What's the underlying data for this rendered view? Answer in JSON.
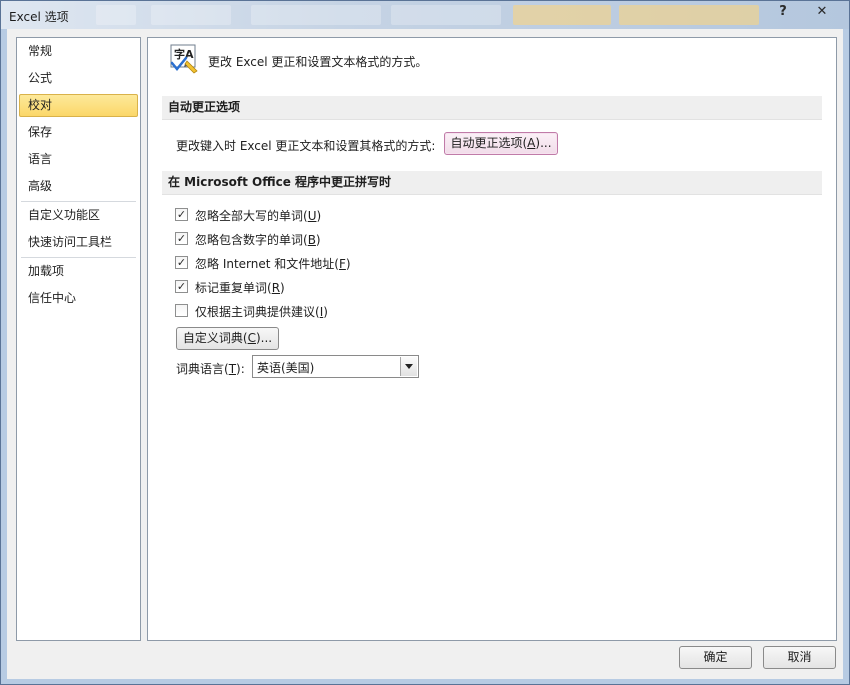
{
  "window": {
    "title": "Excel 选项",
    "help_glyph": "?",
    "close_glyph": "✕"
  },
  "nav": {
    "items": [
      {
        "label": "常规"
      },
      {
        "label": "公式"
      },
      {
        "label": "校对"
      },
      {
        "label": "保存"
      },
      {
        "label": "语言"
      },
      {
        "label": "高级"
      },
      {
        "label": "自定义功能区"
      },
      {
        "label": "快速访问工具栏"
      },
      {
        "label": "加载项"
      },
      {
        "label": "信任中心"
      }
    ],
    "selected": "校对"
  },
  "header": {
    "icon": "abc-check-icon",
    "icon_text": "字A",
    "text": "更改 Excel 更正和设置文本格式的方式。"
  },
  "autocorrect": {
    "section_title": "自动更正选项",
    "label": "更改键入时 Excel 更正文本和设置其格式的方式:",
    "button": {
      "prefix": "自动更正选项(",
      "key": "A",
      "suffix": ")..."
    }
  },
  "spelling": {
    "section_title": "在 Microsoft Office 程序中更正拼写时",
    "options": [
      {
        "prefix": "忽略全部大写的单词(",
        "key": "U",
        "suffix": ")",
        "checked": true
      },
      {
        "prefix": "忽略包含数字的单词(",
        "key": "B",
        "suffix": ")",
        "checked": true
      },
      {
        "prefix": "忽略 Internet 和文件地址(",
        "key": "F",
        "suffix": ")",
        "checked": true
      },
      {
        "prefix": "标记重复单词(",
        "key": "R",
        "suffix": ")",
        "checked": true
      },
      {
        "prefix": "仅根据主词典提供建议(",
        "key": "I",
        "suffix": ")",
        "checked": false
      }
    ],
    "custom_dict_button": {
      "prefix": "自定义词典(",
      "key": "C",
      "suffix": ")..."
    },
    "dict_language_label": {
      "prefix": "词典语言(",
      "key": "T",
      "suffix": "):"
    },
    "dict_language_value": "英语(美国)"
  },
  "footer": {
    "ok": "确定",
    "cancel": "取消"
  },
  "colors": {
    "selection": "#fbd769",
    "focus_border": "#c07ba8"
  }
}
